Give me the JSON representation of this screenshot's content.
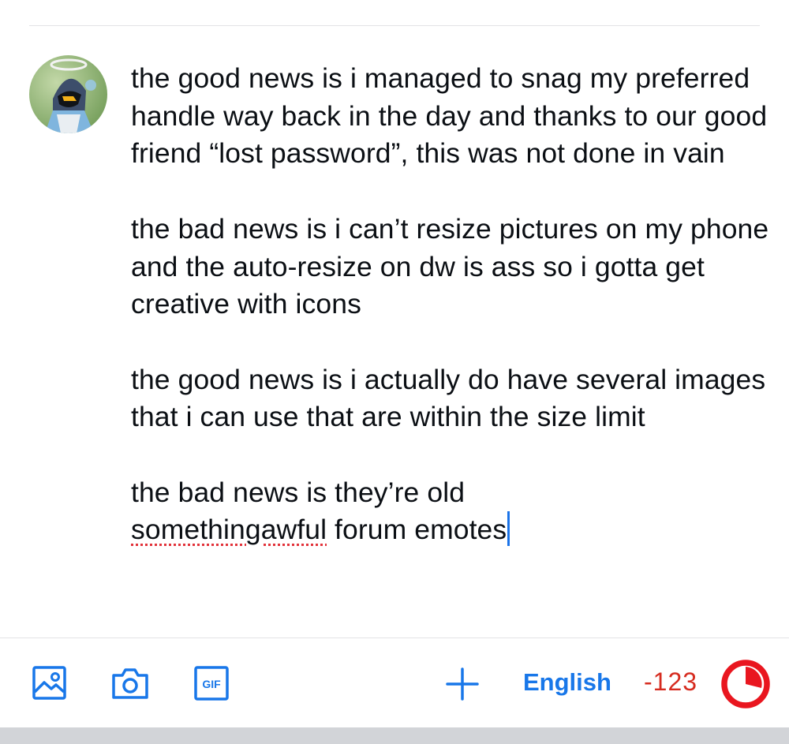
{
  "post": {
    "paragraphs": [
      {
        "text": "the good news is i managed to snag my preferred handle way back in the day and thanks to our good friend “lost password”, this was not done in vain"
      },
      {
        "text": "the bad news is i can’t resize pictures on my phone and the auto-resize on dw is ass so i gotta get creative with icons"
      },
      {
        "text": "the good news is i actually do have several images that i can use that are within the size limit"
      },
      {
        "text_before": "the bad news is they’re old",
        "misspelled": "somethingawful",
        "text_after": " forum emotes"
      }
    ]
  },
  "toolbar": {
    "icons": [
      "image-icon",
      "camera-icon",
      "gif-icon",
      "add-icon"
    ],
    "gif_label": "GIF",
    "language": "English",
    "char_count": "-123",
    "char_limit_progress": 1.0
  },
  "colors": {
    "accent": "#1877e9",
    "over_limit": "#d62b1f",
    "text": "#0b0f14"
  }
}
